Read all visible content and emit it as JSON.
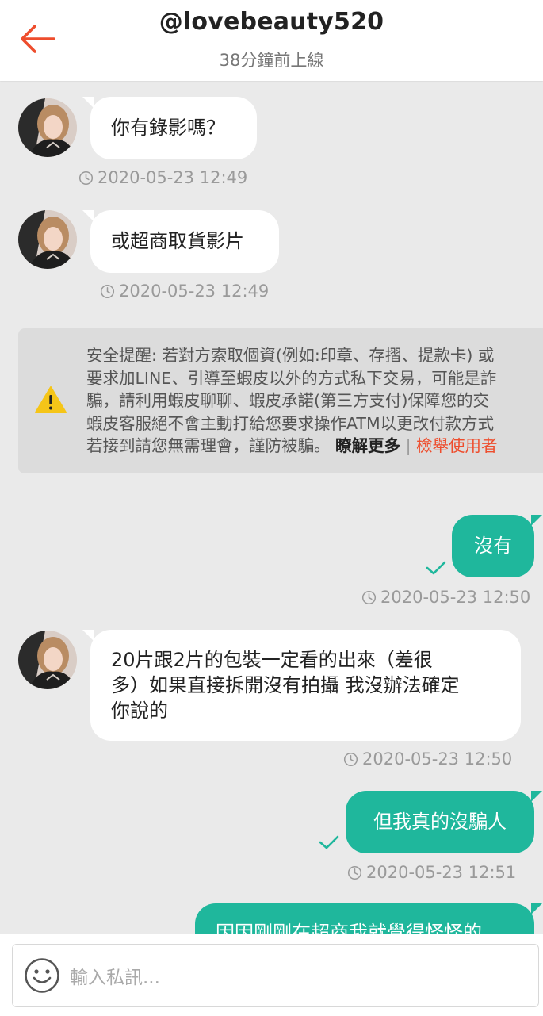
{
  "header": {
    "username": "@lovebeauty520",
    "status": "38分鐘前上線",
    "accent_color": "#ee4d2d",
    "back_icon": "arrow-left-icon"
  },
  "messages": [
    {
      "from": "them",
      "text": "你有錄影嗎？",
      "time": "2020-05-23 12:49"
    },
    {
      "from": "them",
      "text": "或超商取貨影片",
      "time": "2020-05-23 12:49"
    },
    {
      "from": "me",
      "text": "沒有",
      "time": "2020-05-23 12:50",
      "read_icon": "check-icon"
    },
    {
      "from": "them",
      "lines": [
        "20片跟2片的包裝一定看的出來（差很",
        "多）如果直接拆開沒有拍攝 我沒辦法確定",
        "你說的"
      ],
      "time": "2020-05-23 12:50"
    },
    {
      "from": "me",
      "text": "但我真的沒騙人",
      "time": "2020-05-23 12:51",
      "read_icon": "check-icon"
    },
    {
      "from": "me",
      "text": "因因剛剛在超商我就覺得怪怪的"
    }
  ],
  "notice": {
    "icon": "warning-icon",
    "lines": [
      "安全提醒: 若對方索取個資(例如:印章、存摺、提款卡) 或",
      "要求加LINE、引導至蝦皮以外的方式私下交易，可能是詐",
      "騙，請利用蝦皮聊聊、蝦皮承諾(第三方支付)保障您的交",
      "蝦皮客服絕不會主動打給您要求操作ATM以更改付款方式",
      "若接到請您無需理會，謹防被騙。"
    ],
    "learn_more": "瞭解更多",
    "separator": "|",
    "report": "檢舉使用者"
  },
  "input": {
    "placeholder": "輸入私訊...",
    "emoji_icon": "smiley-icon"
  },
  "colors": {
    "outgoing_bubble": "#1fb79c",
    "incoming_bubble": "#ffffff",
    "background": "#eaeaea"
  }
}
